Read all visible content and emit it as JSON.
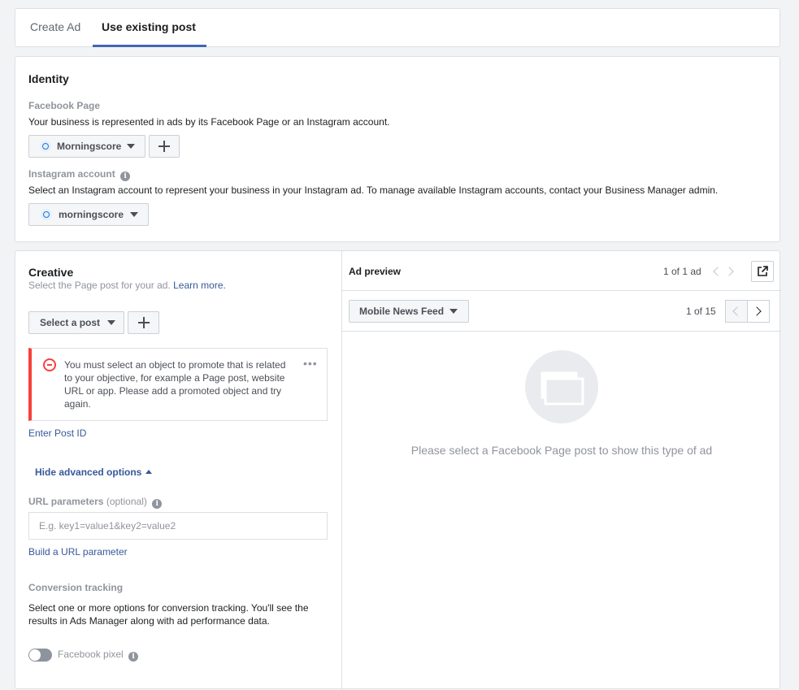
{
  "tabs": [
    {
      "label": "Create Ad",
      "active": false
    },
    {
      "label": "Use existing post",
      "active": true
    }
  ],
  "identity": {
    "title": "Identity",
    "facebook_page": {
      "label": "Facebook Page",
      "description": "Your business is represented in ads by its Facebook Page or an Instagram account.",
      "selected": "Morningscore"
    },
    "instagram": {
      "label": "Instagram account",
      "description": "Select an Instagram account to represent your business in your Instagram ad. To manage available Instagram accounts, contact your Business Manager admin.",
      "selected": "morningscore"
    }
  },
  "creative": {
    "title": "Creative",
    "subtitle": "Select the Page post for your ad.",
    "learn_more": "Learn more.",
    "select_post_label": "Select a post",
    "error_message": "You must select an object to promote that is related to your objective, for example a Page post, website URL or app. Please add a promoted object and try again.",
    "enter_post_id": "Enter Post ID",
    "hide_advanced": "Hide advanced options",
    "url_params_label": "URL parameters",
    "url_params_optional": "(optional)",
    "url_params_placeholder": "E.g. key1=value1&key2=value2",
    "build_url": "Build a URL parameter",
    "conversion_title": "Conversion tracking",
    "conversion_desc": "Select one or more options for conversion tracking. You'll see the results in Ads Manager along with ad performance data.",
    "facebook_pixel": "Facebook pixel",
    "pixel_enabled": false
  },
  "preview": {
    "title": "Ad preview",
    "ad_count": "1 of 1 ad",
    "placement": "Mobile News Feed",
    "placement_count": "1 of 15",
    "empty_message": "Please select a Facebook Page post to show this type of ad"
  },
  "colors": {
    "accent": "#4267b2",
    "link": "#365899",
    "error": "#fa3e3e"
  }
}
